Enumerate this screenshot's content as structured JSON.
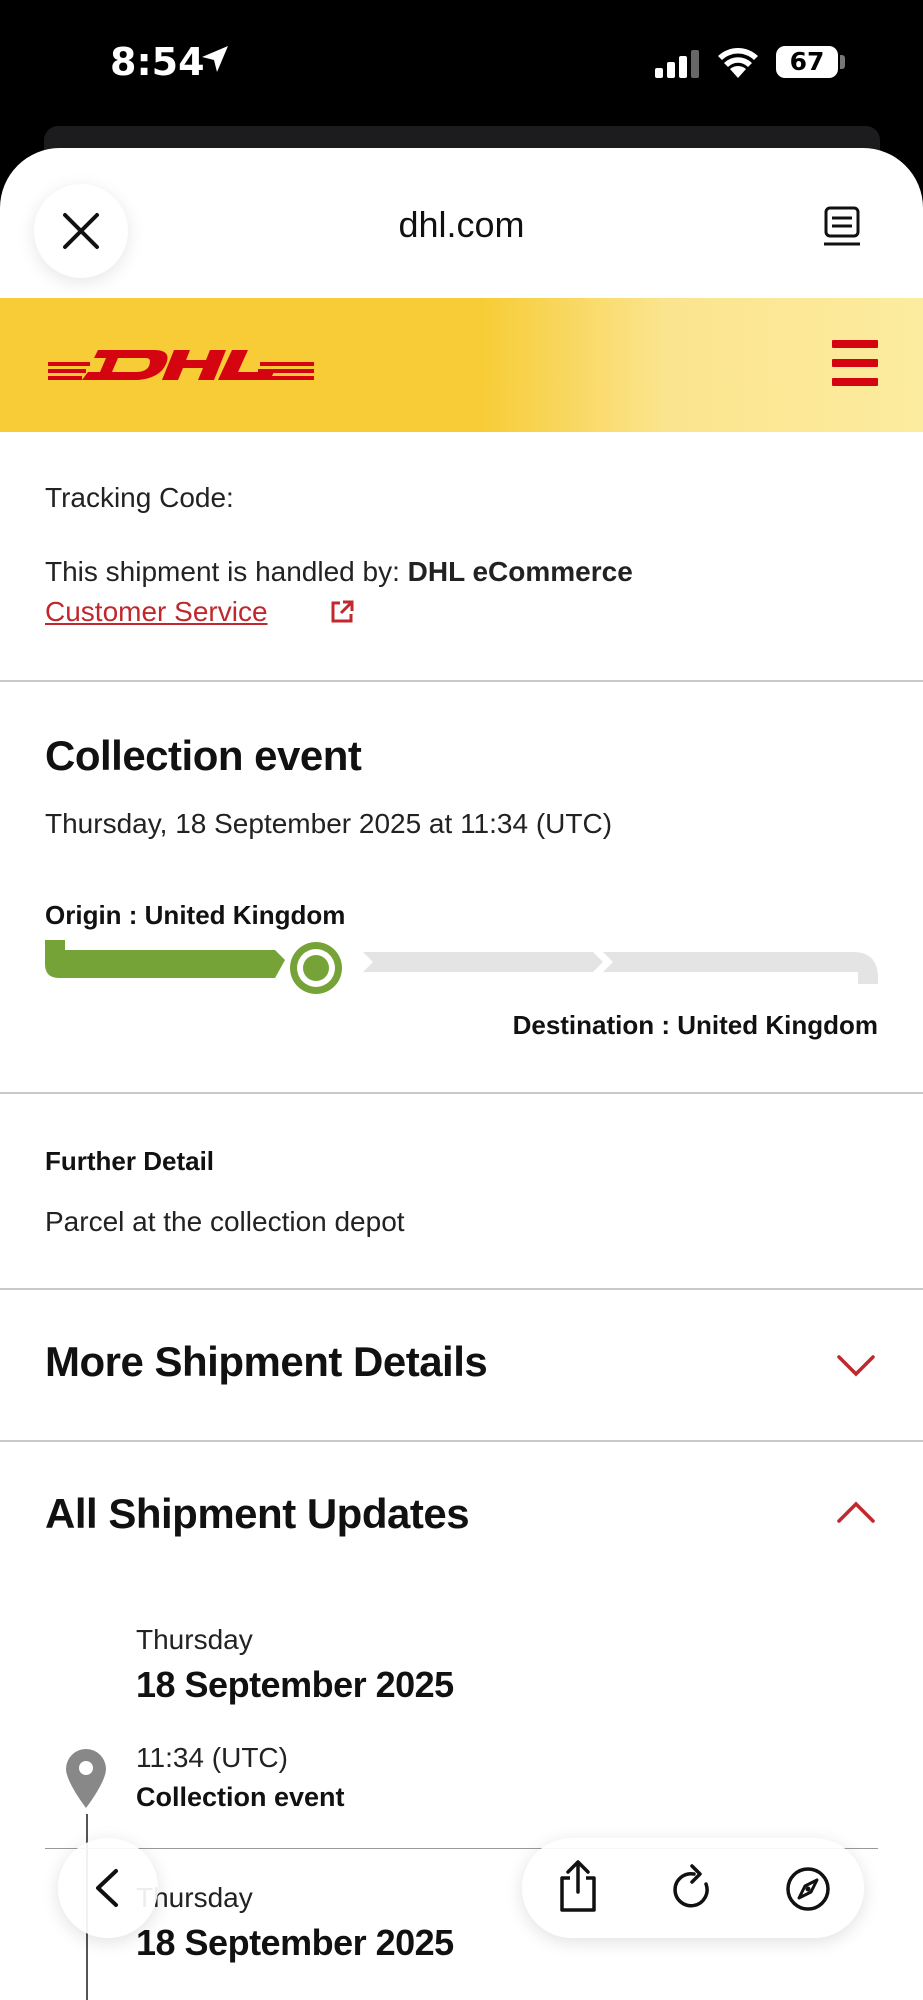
{
  "status_bar": {
    "time": "8:54",
    "battery": "67"
  },
  "browser": {
    "domain": "dhl.com"
  },
  "tracking": {
    "code_label": "Tracking Code:",
    "handled_prefix": "This shipment is handled by: ",
    "handled_by": "DHL eCommerce",
    "customer_service": "Customer Service"
  },
  "status": {
    "heading": "Collection event",
    "datetime": "Thursday, 18 September 2025 at 11:34 (UTC)",
    "origin": "Origin : United Kingdom",
    "destination": "Destination : United Kingdom",
    "progress_fraction": 0.33
  },
  "further_detail": {
    "heading": "Further Detail",
    "text": "Parcel at the collection depot"
  },
  "more_details": {
    "heading": "More Shipment Details"
  },
  "updates": {
    "heading": "All Shipment Updates",
    "groups": [
      {
        "day": "Thursday",
        "date": "18 September 2025",
        "time": "11:34 (UTC)",
        "event": "Collection event"
      },
      {
        "day": "Thursday",
        "date": "18 September 2025"
      }
    ]
  },
  "colors": {
    "dhl_red": "#d40511",
    "dhl_yellow": "#f7cc36",
    "progress_green": "#76a338"
  },
  "icons": [
    "location-arrow-icon",
    "signal-icon",
    "wifi-icon",
    "close-icon",
    "reader-icon",
    "menu-icon",
    "external-link-icon",
    "chevron-down-icon",
    "chevron-up-icon",
    "location-pin-icon",
    "back-icon",
    "share-icon",
    "reload-icon",
    "compass-icon"
  ]
}
